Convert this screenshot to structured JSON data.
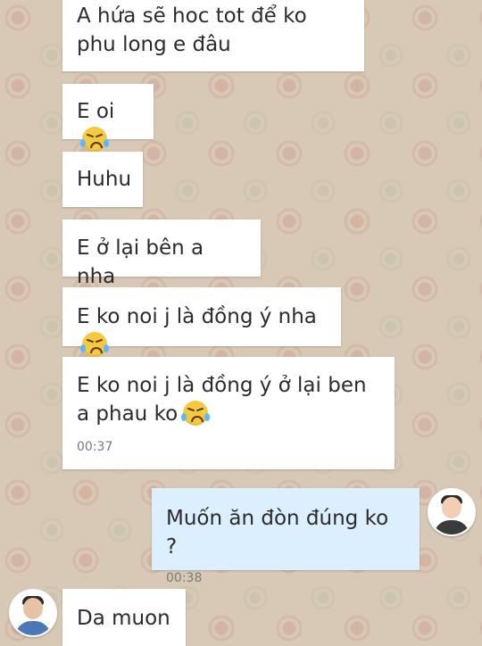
{
  "messages": [
    {
      "text": "A hứa sẽ hoc tot để ko phu long e đâu",
      "emoji": "",
      "time": ""
    },
    {
      "text": "E oi",
      "emoji": "crying-face-icon",
      "time": ""
    },
    {
      "text": "Huhu",
      "emoji": "",
      "time": ""
    },
    {
      "text": "E ở lại bên a nha",
      "emoji": "",
      "time": ""
    },
    {
      "text": "E ko noi j là đồng ý nha",
      "emoji": "crying-face-icon",
      "time": ""
    },
    {
      "text": "E ko noi j là đồng ý ở lại ben a phau ko",
      "emoji": "crying-face-icon",
      "time": "00:37"
    },
    {
      "text": "Muốn ăn đòn đúng ko ?",
      "emoji": "",
      "time": "00:38",
      "direction": "outgoing"
    },
    {
      "text": "Da muon",
      "emoji": "",
      "time": ""
    }
  ],
  "colors": {
    "incoming_bubble": "#ffffff",
    "outgoing_bubble": "#dcefff",
    "background": "#d8c9b6",
    "emoji_face": "#f7c93e",
    "emoji_tear": "#59b9ff"
  }
}
